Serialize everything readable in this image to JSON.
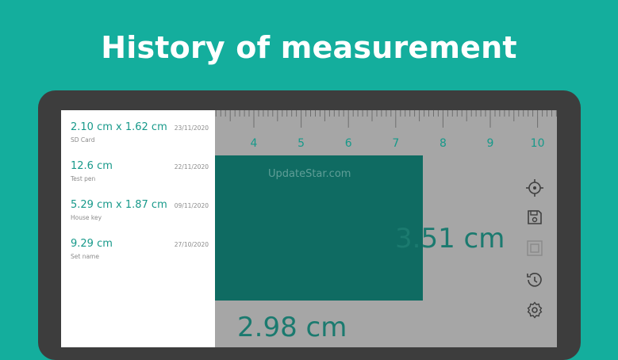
{
  "headline": "History of measurement",
  "history": [
    {
      "value": "2.10 cm x 1.62 cm",
      "date": "23/11/2020",
      "name": "SD Card"
    },
    {
      "value": "12.6 cm",
      "date": "22/11/2020",
      "name": "Test pen"
    },
    {
      "value": "5.29 cm x 1.87 cm",
      "date": "09/11/2020",
      "name": "House key"
    },
    {
      "value": "9.29 cm",
      "date": "27/10/2020",
      "name": "Set name"
    }
  ],
  "ruler": {
    "labels": [
      "4",
      "5",
      "6",
      "7",
      "8",
      "9",
      "10"
    ],
    "color": "#17998a"
  },
  "measurement": {
    "height": "3.51 cm",
    "width": "2.98 cm",
    "rect_color": "#0f6b62"
  },
  "watermark": "UpdateStar.com",
  "toolbar": {
    "icons": [
      "crosshair-icon",
      "save-icon",
      "frame-icon",
      "history-icon",
      "settings-icon"
    ]
  },
  "colors": {
    "background": "#14ae9d",
    "accent": "#17998a",
    "screen": "#a6a6a6"
  }
}
